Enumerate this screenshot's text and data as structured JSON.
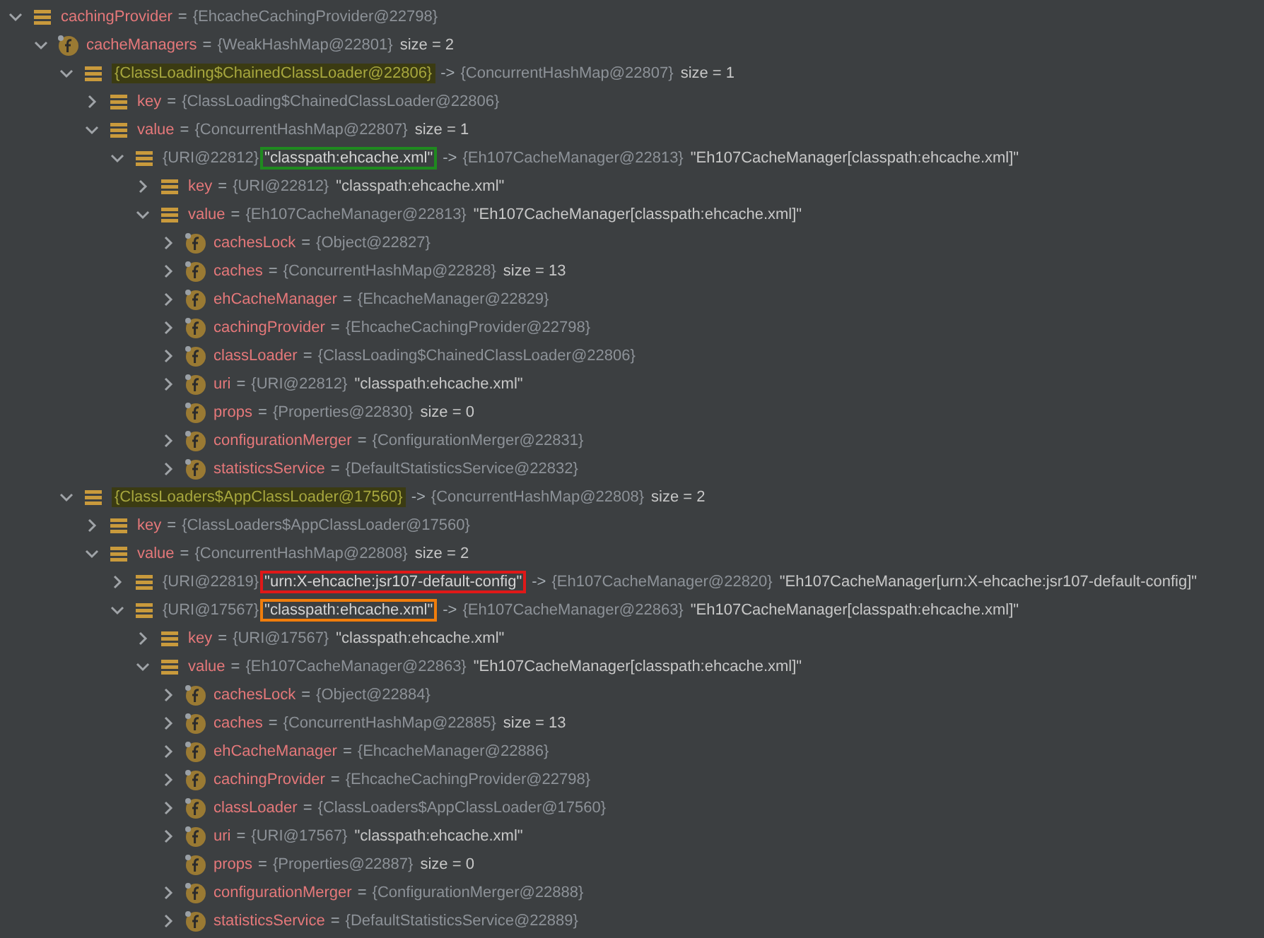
{
  "tree": [
    {
      "kind": "list",
      "expandable": true,
      "expanded": true,
      "name": "cachingProvider",
      "op": "=",
      "ref": "{EhcacheCachingProvider@22798}",
      "children": [
        {
          "kind": "field",
          "expandable": true,
          "expanded": true,
          "name": "cacheManagers",
          "op": "=",
          "ref": "{WeakHashMap@22801}",
          "size": "size = 2",
          "children": [
            {
              "kind": "list",
              "expandable": true,
              "expanded": true,
              "key": {
                "text": "{ClassLoading$ChainedClassLoader@22806}",
                "kind": "highlight"
              },
              "op": "->",
              "ref": "{ConcurrentHashMap@22807}",
              "size": "size = 1",
              "children": [
                {
                  "kind": "list",
                  "expandable": true,
                  "expanded": false,
                  "name": "key",
                  "op": "=",
                  "ref": "{ClassLoading$ChainedClassLoader@22806}"
                },
                {
                  "kind": "list",
                  "expandable": true,
                  "expanded": true,
                  "name": "value",
                  "op": "=",
                  "ref": "{ConcurrentHashMap@22807}",
                  "size": "size = 1",
                  "children": [
                    {
                      "kind": "list",
                      "expandable": true,
                      "expanded": true,
                      "key_ref": "{URI@22812}",
                      "key": {
                        "text": "\"classpath:ehcache.xml\"",
                        "kind": "box",
                        "color": "#1f8a1f"
                      },
                      "op": "->",
                      "ref": "{Eh107CacheManager@22813}",
                      "value": "\"Eh107CacheManager[classpath:ehcache.xml]\"",
                      "children": [
                        {
                          "kind": "list",
                          "expandable": true,
                          "expanded": false,
                          "name": "key",
                          "op": "=",
                          "ref": "{URI@22812}",
                          "value": "\"classpath:ehcache.xml\""
                        },
                        {
                          "kind": "list",
                          "expandable": true,
                          "expanded": true,
                          "name": "value",
                          "op": "=",
                          "ref": "{Eh107CacheManager@22813}",
                          "value": "\"Eh107CacheManager[classpath:ehcache.xml]\"",
                          "children": [
                            {
                              "kind": "field",
                              "expandable": true,
                              "expanded": false,
                              "name": "cachesLock",
                              "op": "=",
                              "ref": "{Object@22827}"
                            },
                            {
                              "kind": "field",
                              "expandable": true,
                              "expanded": false,
                              "name": "caches",
                              "op": "=",
                              "ref": "{ConcurrentHashMap@22828}",
                              "size": "size = 13"
                            },
                            {
                              "kind": "field",
                              "expandable": true,
                              "expanded": false,
                              "name": "ehCacheManager",
                              "op": "=",
                              "ref": "{EhcacheManager@22829}"
                            },
                            {
                              "kind": "field",
                              "expandable": true,
                              "expanded": false,
                              "name": "cachingProvider",
                              "op": "=",
                              "ref": "{EhcacheCachingProvider@22798}"
                            },
                            {
                              "kind": "field",
                              "expandable": true,
                              "expanded": false,
                              "name": "classLoader",
                              "op": "=",
                              "ref": "{ClassLoading$ChainedClassLoader@22806}"
                            },
                            {
                              "kind": "field",
                              "expandable": true,
                              "expanded": false,
                              "name": "uri",
                              "op": "=",
                              "ref": "{URI@22812}",
                              "value": "\"classpath:ehcache.xml\""
                            },
                            {
                              "kind": "field",
                              "expandable": false,
                              "name": "props",
                              "op": "=",
                              "ref": "{Properties@22830}",
                              "size": "size = 0"
                            },
                            {
                              "kind": "field",
                              "expandable": true,
                              "expanded": false,
                              "name": "configurationMerger",
                              "op": "=",
                              "ref": "{ConfigurationMerger@22831}"
                            },
                            {
                              "kind": "field",
                              "expandable": true,
                              "expanded": false,
                              "name": "statisticsService",
                              "op": "=",
                              "ref": "{DefaultStatisticsService@22832}"
                            }
                          ]
                        }
                      ]
                    }
                  ]
                }
              ]
            },
            {
              "kind": "list",
              "expandable": true,
              "expanded": true,
              "key": {
                "text": "{ClassLoaders$AppClassLoader@17560}",
                "kind": "highlight"
              },
              "op": "->",
              "ref": "{ConcurrentHashMap@22808}",
              "size": "size = 2",
              "children": [
                {
                  "kind": "list",
                  "expandable": true,
                  "expanded": false,
                  "name": "key",
                  "op": "=",
                  "ref": "{ClassLoaders$AppClassLoader@17560}"
                },
                {
                  "kind": "list",
                  "expandable": true,
                  "expanded": true,
                  "name": "value",
                  "op": "=",
                  "ref": "{ConcurrentHashMap@22808}",
                  "size": "size = 2",
                  "children": [
                    {
                      "kind": "list",
                      "expandable": true,
                      "expanded": false,
                      "key_ref": "{URI@22819}",
                      "key": {
                        "text": "\"urn:X-ehcache:jsr107-default-config\"",
                        "kind": "box",
                        "color": "#e01818"
                      },
                      "op": "->",
                      "ref": "{Eh107CacheManager@22820}",
                      "value": "\"Eh107CacheManager[urn:X-ehcache:jsr107-default-config]\""
                    },
                    {
                      "kind": "list",
                      "expandable": true,
                      "expanded": true,
                      "key_ref": "{URI@17567}",
                      "key": {
                        "text": "\"classpath:ehcache.xml\"",
                        "kind": "box",
                        "color": "#f07d0c"
                      },
                      "op": "->",
                      "ref": "{Eh107CacheManager@22863}",
                      "value": "\"Eh107CacheManager[classpath:ehcache.xml]\"",
                      "children": [
                        {
                          "kind": "list",
                          "expandable": true,
                          "expanded": false,
                          "name": "key",
                          "op": "=",
                          "ref": "{URI@17567}",
                          "value": "\"classpath:ehcache.xml\""
                        },
                        {
                          "kind": "list",
                          "expandable": true,
                          "expanded": true,
                          "name": "value",
                          "op": "=",
                          "ref": "{Eh107CacheManager@22863}",
                          "value": "\"Eh107CacheManager[classpath:ehcache.xml]\"",
                          "children": [
                            {
                              "kind": "field",
                              "expandable": true,
                              "expanded": false,
                              "name": "cachesLock",
                              "op": "=",
                              "ref": "{Object@22884}"
                            },
                            {
                              "kind": "field",
                              "expandable": true,
                              "expanded": false,
                              "name": "caches",
                              "op": "=",
                              "ref": "{ConcurrentHashMap@22885}",
                              "size": "size = 13"
                            },
                            {
                              "kind": "field",
                              "expandable": true,
                              "expanded": false,
                              "name": "ehCacheManager",
                              "op": "=",
                              "ref": "{EhcacheManager@22886}"
                            },
                            {
                              "kind": "field",
                              "expandable": true,
                              "expanded": false,
                              "name": "cachingProvider",
                              "op": "=",
                              "ref": "{EhcacheCachingProvider@22798}"
                            },
                            {
                              "kind": "field",
                              "expandable": true,
                              "expanded": false,
                              "name": "classLoader",
                              "op": "=",
                              "ref": "{ClassLoaders$AppClassLoader@17560}"
                            },
                            {
                              "kind": "field",
                              "expandable": true,
                              "expanded": false,
                              "name": "uri",
                              "op": "=",
                              "ref": "{URI@17567}",
                              "value": "\"classpath:ehcache.xml\""
                            },
                            {
                              "kind": "field",
                              "expandable": false,
                              "name": "props",
                              "op": "=",
                              "ref": "{Properties@22887}",
                              "size": "size = 0"
                            },
                            {
                              "kind": "field",
                              "expandable": true,
                              "expanded": false,
                              "name": "configurationMerger",
                              "op": "=",
                              "ref": "{ConfigurationMerger@22888}"
                            },
                            {
                              "kind": "field",
                              "expandable": true,
                              "expanded": false,
                              "name": "statisticsService",
                              "op": "=",
                              "ref": "{DefaultStatisticsService@22889}"
                            }
                          ]
                        }
                      ]
                    }
                  ]
                }
              ]
            }
          ]
        }
      ]
    }
  ]
}
